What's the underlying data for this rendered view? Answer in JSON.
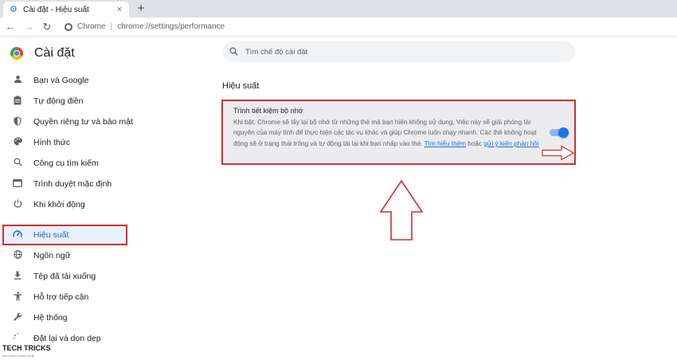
{
  "browser": {
    "tab_title": "Cài đặt - Hiệu suất",
    "tab_close": "×",
    "new_tab": "+",
    "omnibox_brand": "Chrome",
    "omnibox_url": "chrome://settings/performance"
  },
  "sidebar": {
    "title": "Cài đặt",
    "items": [
      {
        "label": "Bạn và Google",
        "icon": "person-icon"
      },
      {
        "label": "Tự động điền",
        "icon": "clipboard-icon"
      },
      {
        "label": "Quyền riêng tư và bảo mật",
        "icon": "shield-icon"
      },
      {
        "label": "Hình thức",
        "icon": "palette-icon"
      },
      {
        "label": "Công cụ tìm kiếm",
        "icon": "search-icon"
      },
      {
        "label": "Trình duyệt mặc định",
        "icon": "browser-icon"
      },
      {
        "label": "Khi khởi động",
        "icon": "power-icon"
      },
      {
        "label": "Hiệu suất",
        "icon": "speedometer-icon",
        "active": true
      },
      {
        "label": "Ngôn ngữ",
        "icon": "globe-icon"
      },
      {
        "label": "Tệp đã tải xuống",
        "icon": "download-icon"
      },
      {
        "label": "Hỗ trợ tiếp cận",
        "icon": "accessibility-icon"
      },
      {
        "label": "Hệ thống",
        "icon": "wrench-icon"
      },
      {
        "label": "Đặt lại và dọn dẹp",
        "icon": "reset-icon"
      }
    ]
  },
  "search": {
    "placeholder": "Tìm chế độ cài đặt"
  },
  "main": {
    "section_title": "Hiệu suất",
    "card": {
      "title": "Trình tiết kiệm bộ nhớ",
      "description": "Khi bật, Chrome sẽ lấy lại bộ nhớ từ những thẻ mà bạn hiện không sử dụng. Việc này sẽ giải phóng tài nguyên của máy tính để thực hiện các tác vụ khác và giúp Chrome luôn chạy nhanh. Các thẻ không hoạt động sẽ ở trạng thái trống và tự động tải lại khi bạn nhấp vào thẻ.",
      "learn_more": "Tìm hiểu thêm",
      "or_text": "hoặc",
      "feedback_link": "gửi ý kiến phản hồi",
      "toggle_on": true
    }
  },
  "watermark": {
    "brand": "TECH TRICKS",
    "tagline": "THỦ THUẬT CÔNG NGHỆ"
  },
  "colors": {
    "accent": "#1a73e8",
    "highlight_border": "#d32f2f",
    "active_bg": "#e8f0fe"
  }
}
